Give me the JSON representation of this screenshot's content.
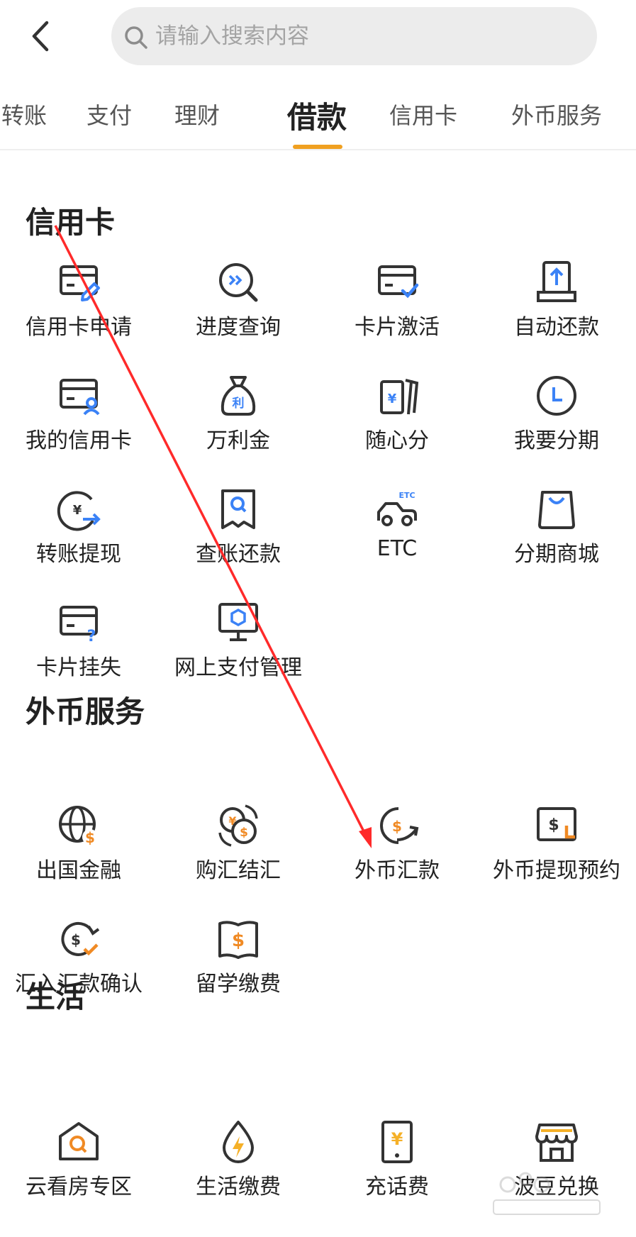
{
  "search": {
    "placeholder": "请输入搜索内容"
  },
  "tabs": [
    {
      "label": "转账"
    },
    {
      "label": "支付"
    },
    {
      "label": "理财"
    },
    {
      "label": "借款",
      "active": true
    },
    {
      "label": "信用卡"
    },
    {
      "label": "外币服务"
    }
  ],
  "sections": {
    "credit": {
      "title": "信用卡",
      "items": [
        {
          "label": "信用卡申请",
          "icon": "card-edit-icon"
        },
        {
          "label": "进度查询",
          "icon": "progress-search-icon"
        },
        {
          "label": "卡片激活",
          "icon": "card-check-icon"
        },
        {
          "label": "自动还款",
          "icon": "auto-repay-icon"
        },
        {
          "label": "我的信用卡",
          "icon": "card-user-icon"
        },
        {
          "label": "万利金",
          "icon": "money-bag-icon"
        },
        {
          "label": "随心分",
          "icon": "notes-stack-icon"
        },
        {
          "label": "我要分期",
          "icon": "clock-icon"
        },
        {
          "label": "转账提现",
          "icon": "yuan-transfer-icon"
        },
        {
          "label": "查账还款",
          "icon": "receipt-search-icon"
        },
        {
          "label": "ETC",
          "icon": "etc-car-icon",
          "badge": "ETC"
        },
        {
          "label": "分期商城",
          "icon": "shopping-bag-icon"
        },
        {
          "label": "卡片挂失",
          "icon": "card-question-icon"
        },
        {
          "label": "网上支付管理",
          "icon": "monitor-shield-icon"
        }
      ]
    },
    "forex": {
      "title": "外币服务",
      "items": [
        {
          "label": "出国金融",
          "icon": "globe-dollar-icon"
        },
        {
          "label": "购汇结汇",
          "icon": "currency-exchange-icon"
        },
        {
          "label": "外币汇款",
          "icon": "dollar-send-icon"
        },
        {
          "label": "外币提现预约",
          "icon": "screen-dollar-icon"
        },
        {
          "label": "汇入汇款确认",
          "icon": "dollar-confirm-icon"
        },
        {
          "label": "留学缴费",
          "icon": "book-dollar-icon"
        }
      ]
    },
    "life": {
      "title": "生活",
      "items": [
        {
          "label": "云看房专区",
          "icon": "house-search-icon"
        },
        {
          "label": "生活缴费",
          "icon": "utility-bolt-icon"
        },
        {
          "label": "充话费",
          "icon": "phone-yuan-icon"
        },
        {
          "label": "波豆兑换",
          "icon": "store-icon"
        }
      ]
    }
  },
  "colors": {
    "accent": "#f0a020",
    "blue": "#3b82f6",
    "orange": "#f08a24",
    "annotation": "#ff2a2a"
  }
}
